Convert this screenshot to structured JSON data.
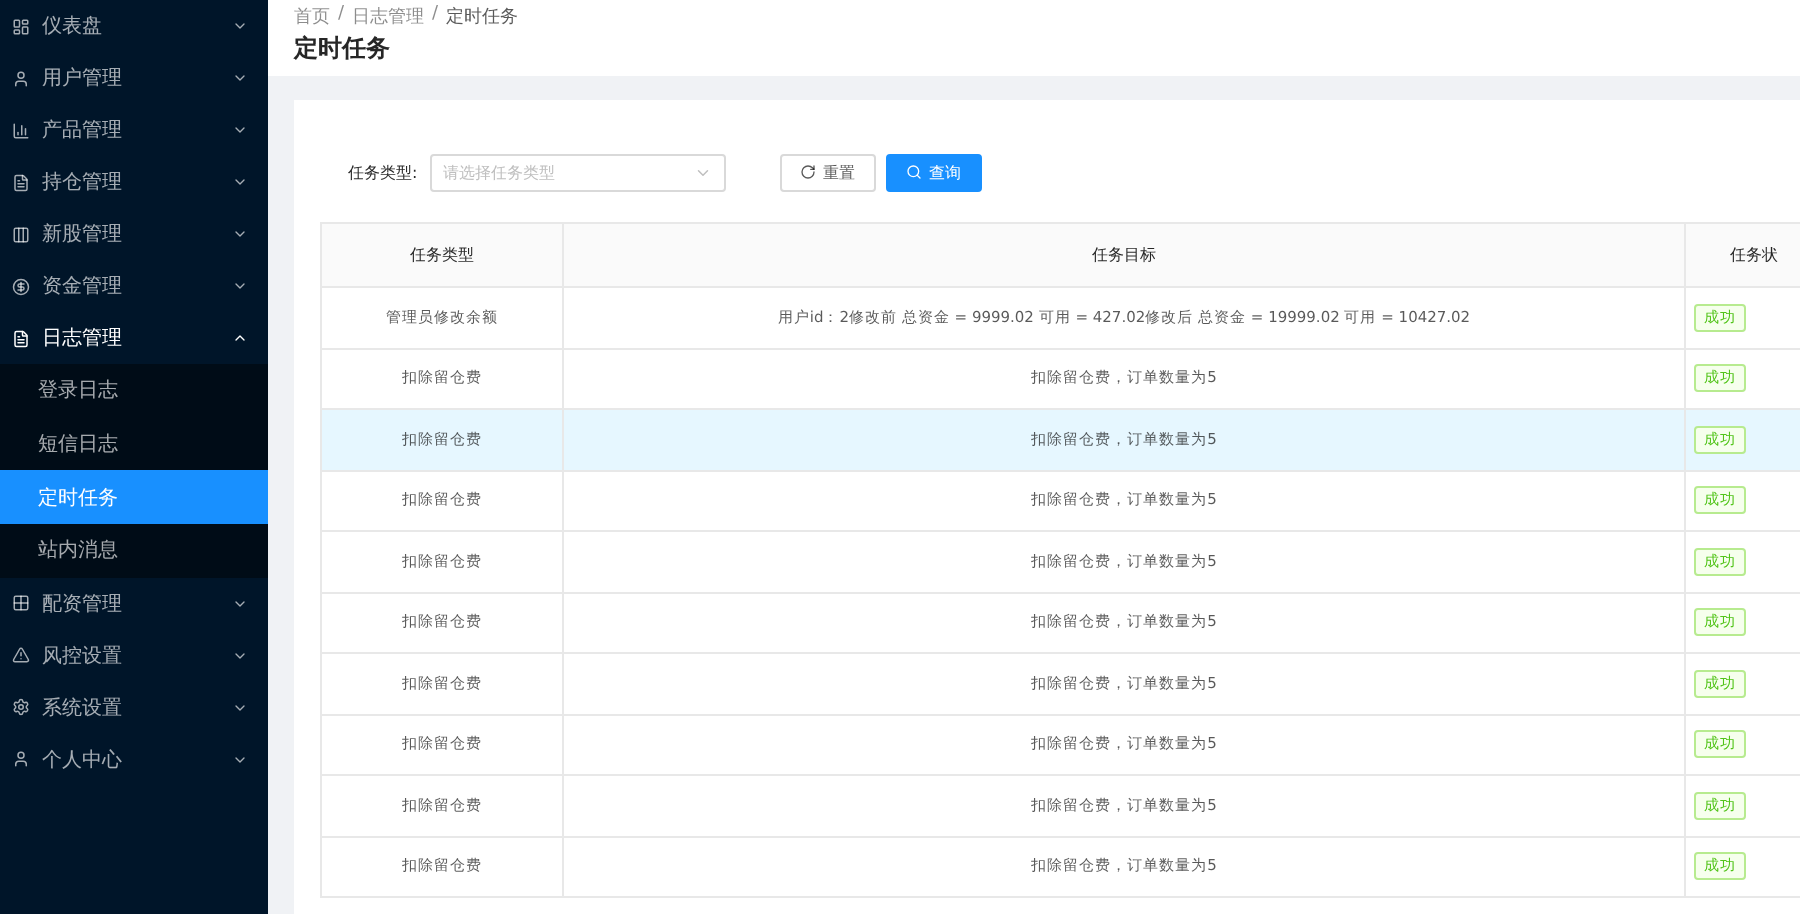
{
  "sidebar": {
    "items": [
      {
        "label": "仪表盘",
        "expanded": false
      },
      {
        "label": "用户管理",
        "expanded": false
      },
      {
        "label": "产品管理",
        "expanded": false
      },
      {
        "label": "持仓管理",
        "expanded": false
      },
      {
        "label": "新股管理",
        "expanded": false
      },
      {
        "label": "资金管理",
        "expanded": false
      },
      {
        "label": "日志管理",
        "expanded": true,
        "children": [
          {
            "label": "登录日志",
            "selected": false
          },
          {
            "label": "短信日志",
            "selected": false
          },
          {
            "label": "定时任务",
            "selected": true
          },
          {
            "label": "站内消息",
            "selected": false
          }
        ]
      },
      {
        "label": "配资管理",
        "expanded": false
      },
      {
        "label": "风控设置",
        "expanded": false
      },
      {
        "label": "系统设置",
        "expanded": false
      },
      {
        "label": "个人中心",
        "expanded": false
      }
    ]
  },
  "breadcrumb": [
    "首页",
    "日志管理",
    "定时任务"
  ],
  "breadcrumb_separator": "/",
  "page_title": "定时任务",
  "filter": {
    "label": "任务类型:",
    "placeholder": "请选择任务类型",
    "buttons": [
      {
        "label": "重置",
        "kind": "default"
      },
      {
        "label": "查询",
        "kind": "primary"
      }
    ]
  },
  "table": {
    "columns": [
      "任务类型",
      "任务目标",
      "任务状"
    ],
    "rows": [
      {
        "type": "管理员修改余额",
        "target": "用户id：2修改前 总资金 = 9999.02 可用 = 427.02修改后 总资金 = 19999.02 可用 = 10427.02",
        "status": "成功",
        "selected": false
      },
      {
        "type": "扣除留仓费",
        "target": "扣除留仓费，订单数量为5",
        "status": "成功",
        "selected": false
      },
      {
        "type": "扣除留仓费",
        "target": "扣除留仓费，订单数量为5",
        "status": "成功",
        "selected": true
      },
      {
        "type": "扣除留仓费",
        "target": "扣除留仓费，订单数量为5",
        "status": "成功",
        "selected": false
      },
      {
        "type": "扣除留仓费",
        "target": "扣除留仓费，订单数量为5",
        "status": "成功",
        "selected": false
      },
      {
        "type": "扣除留仓费",
        "target": "扣除留仓费，订单数量为5",
        "status": "成功",
        "selected": false
      },
      {
        "type": "扣除留仓费",
        "target": "扣除留仓费，订单数量为5",
        "status": "成功",
        "selected": false
      },
      {
        "type": "扣除留仓费",
        "target": "扣除留仓费，订单数量为5",
        "status": "成功",
        "selected": false
      },
      {
        "type": "扣除留仓费",
        "target": "扣除留仓费，订单数量为5",
        "status": "成功",
        "selected": false
      },
      {
        "type": "扣除留仓费",
        "target": "扣除留仓费，订单数量为5",
        "status": "成功",
        "selected": false
      }
    ]
  }
}
